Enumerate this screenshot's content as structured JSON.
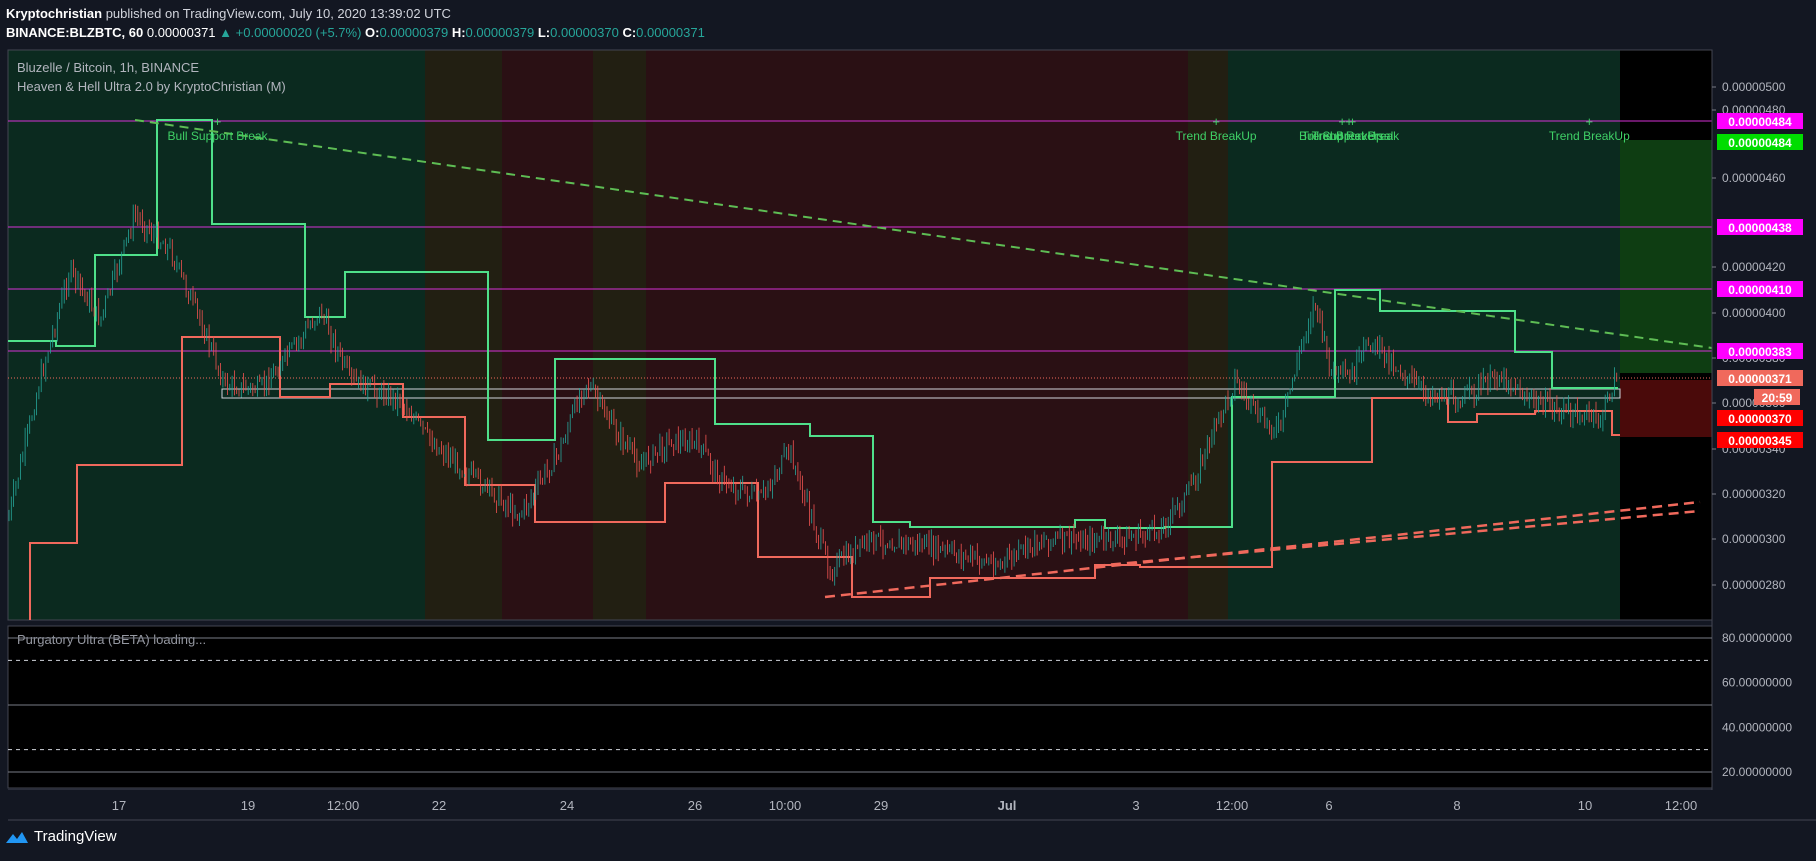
{
  "header": {
    "author": "Kryptochristian",
    "published_text": "published on TradingView.com, July 10, 2020 13:39:02 UTC",
    "symbol": "BINANCE:BLZBTC, 60",
    "last": "0.00000371",
    "change": "▲ +0.00000020 (+5.7%)",
    "o_label": "O:",
    "o": "0.00000379",
    "h_label": "H:",
    "h": "0.00000379",
    "l_label": "L:",
    "l": "0.00000370",
    "c_label": "C:",
    "c": "0.00000371"
  },
  "legend": {
    "title": "Bluzelle / Bitcoin, 1h, BINANCE",
    "indicator": "Heaven & Hell Ultra 2.0 by KryptoChristian (M)",
    "sub_indicator": "Purgatory Ultra (BETA) loading..."
  },
  "footer": {
    "brand": "TradingView"
  },
  "colors": {
    "background": "#131722",
    "bull_zone": "#0b2a1f",
    "bear_zone": "#2a1014",
    "neutral_zone": "#221f12",
    "upper_band": "#4fe08a",
    "lower_band": "#f0695c",
    "level_line": "#d531d5",
    "candle_up": "#26a69a",
    "candle_down": "#ef5350"
  },
  "chart_data": {
    "type": "candlestick",
    "symbol": "BLZBTC",
    "timeframe": "1h",
    "x_ticks": [
      "17",
      "19",
      "12:00",
      "22",
      "24",
      "26",
      "10:00",
      "29",
      "Jul",
      "3",
      "12:00",
      "6",
      "8",
      "10",
      "12:00"
    ],
    "y_ticks": [
      "0.00000500",
      "0.00000480",
      "0.00000460",
      "0.00000420",
      "0.00000400",
      "0.00000380",
      "0.00000360",
      "0.00000340",
      "0.00000320",
      "0.00000300",
      "0.00000280"
    ],
    "ylim": [
      2.7e-06,
      5.2e-06
    ],
    "price_labels": [
      {
        "text": "0.00000484",
        "value": 4.84e-06,
        "color": "#ff00ff"
      },
      {
        "text": "0.00000484",
        "value": 4.84e-06,
        "color": "#00dd00",
        "offset": 1
      },
      {
        "text": "0.00000438",
        "value": 4.38e-06,
        "color": "#ff00ff"
      },
      {
        "text": "0.00000410",
        "value": 4.1e-06,
        "color": "#ff00ff"
      },
      {
        "text": "0.00000383",
        "value": 3.83e-06,
        "color": "#ff00ff"
      },
      {
        "text": "0.00000371",
        "value": 3.71e-06,
        "color": "#f0695c"
      },
      {
        "text": "20:59",
        "value": 3.59e-06,
        "color": "#f0695c",
        "countdown": true
      },
      {
        "text": "0.00000370",
        "value": 3.47e-06,
        "color": "#ff0000"
      },
      {
        "text": "0.00000345",
        "value": 3.38e-06,
        "color": "#ff0000"
      }
    ],
    "annotations": [
      {
        "text": "Bull Support Break",
        "x": 0.123
      },
      {
        "text": "Trend BreakUp",
        "x": 0.709
      },
      {
        "text": "Trend BreakUp",
        "x": 0.783
      },
      {
        "text": "Bull Support Break",
        "x": 0.787
      },
      {
        "text": "Trend Reversal",
        "x": 0.789
      },
      {
        "text": "Trend BreakUp",
        "x": 0.928
      }
    ],
    "osc_ticks": [
      "80.00000000",
      "60.00000000",
      "40.00000000",
      "20.00000000"
    ],
    "osc_lines": [
      80,
      70,
      50,
      30,
      20
    ]
  }
}
